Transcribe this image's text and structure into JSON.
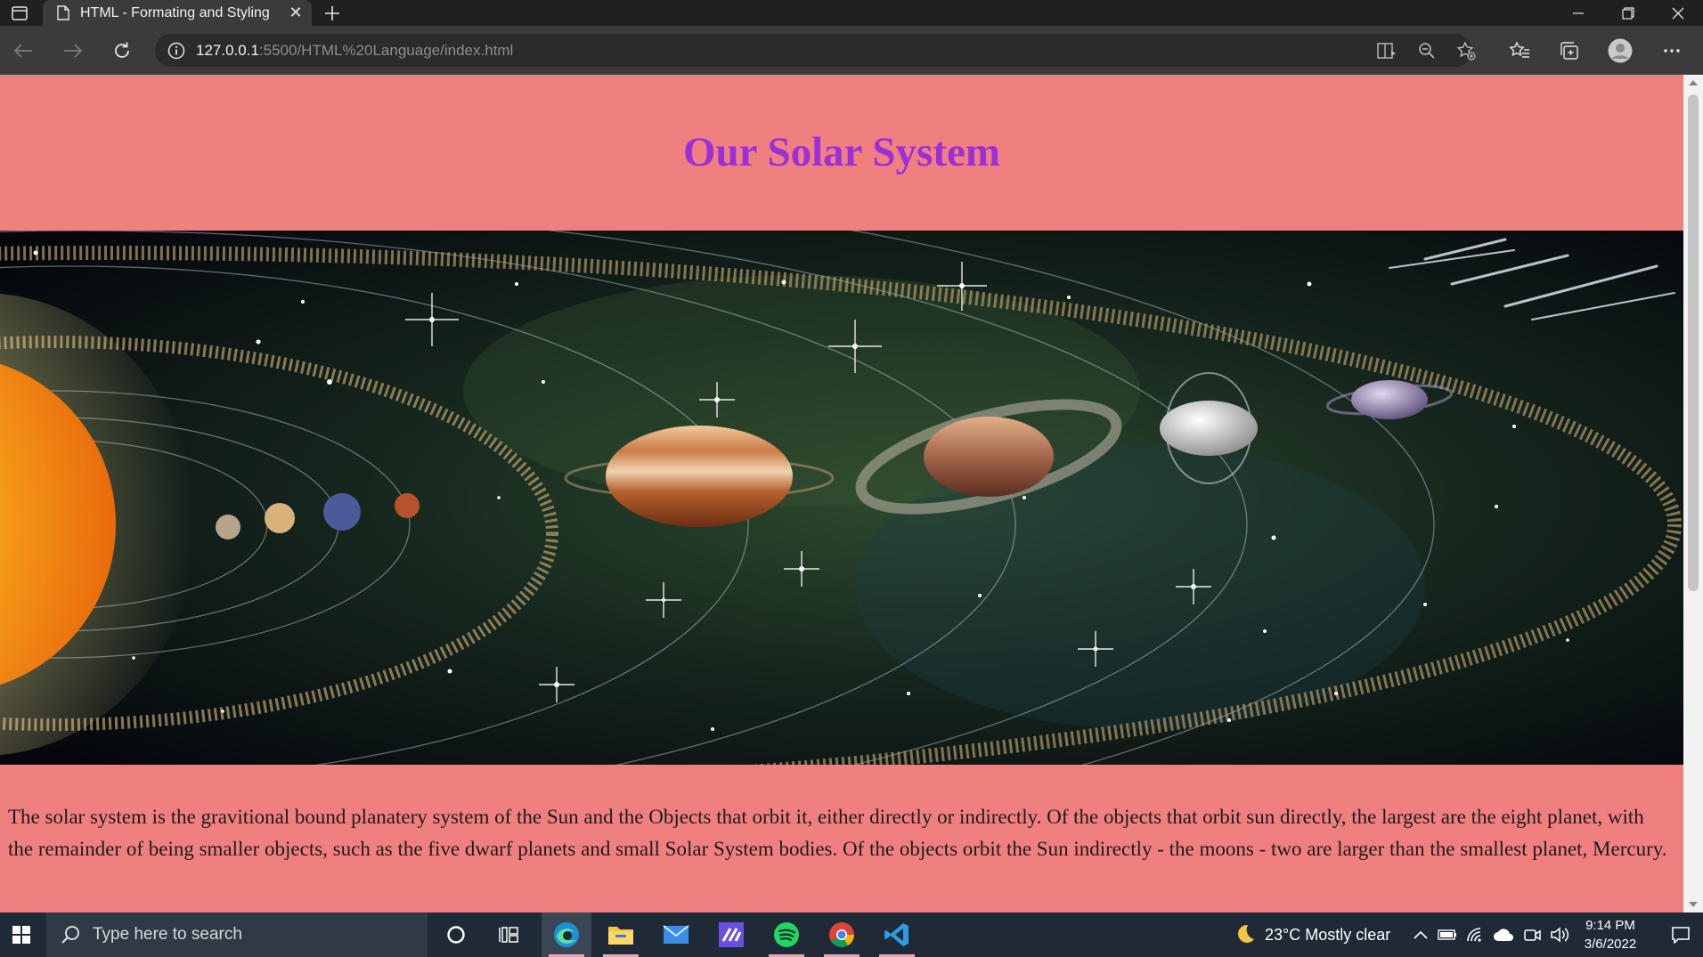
{
  "browser": {
    "tab_title": "HTML - Formating and Styling",
    "close_glyph": "✕",
    "url_host": "127.0.0.1",
    "url_path": ":5500/HTML%20Language/index.html"
  },
  "page": {
    "heading": "Our Solar System",
    "body_text": "The solar system is the gravitional bound planatery system of the Sun and the Objects that orbit it, either directly or indirectly. Of the objects that orbit sun directly, the largest are the eight planet, with the remainder of being smaller objects, such as the five dwarf planets and small Solar System bodies. Of the objects orbit the Sun indirectly - the moons - two are larger than the smallest planet, Mercury.",
    "background_color": "#f08080",
    "heading_color": "#9b30d9"
  },
  "taskbar": {
    "search_placeholder": "Type here to search",
    "weather": "23°C  Mostly clear",
    "time": "9:14 PM",
    "date": "3/6/2022",
    "apps": [
      "cortana-icon",
      "task-view-icon",
      "edge-icon",
      "file-explorer-icon",
      "mail-icon",
      "visual-studio-icon",
      "spotify-icon",
      "chrome-icon",
      "vscode-icon"
    ]
  }
}
